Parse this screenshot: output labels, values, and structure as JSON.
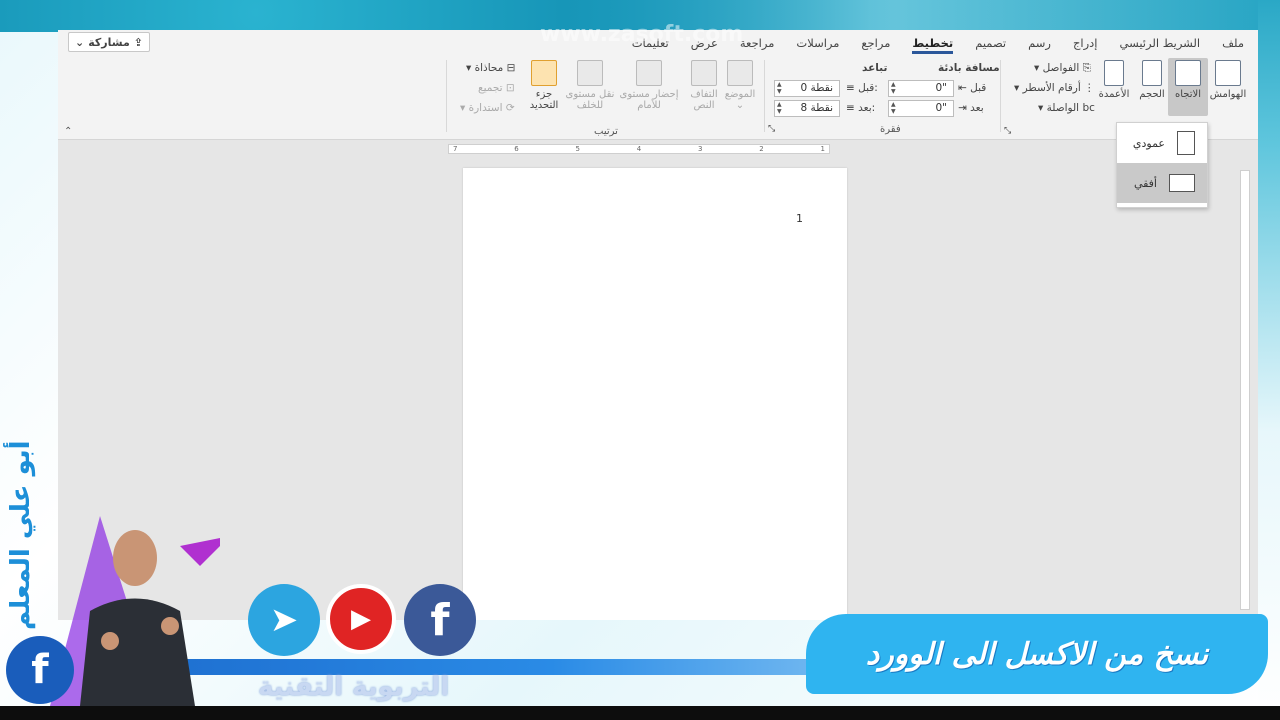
{
  "watermark": "www.zasoft.com",
  "tabs": [
    {
      "label": "ملف"
    },
    {
      "label": "الشريط الرئيسي"
    },
    {
      "label": "إدراج"
    },
    {
      "label": "رسم"
    },
    {
      "label": "تصميم"
    },
    {
      "label": "تخطيط",
      "active": true
    },
    {
      "label": "مراجع"
    },
    {
      "label": "مراسلات"
    },
    {
      "label": "مراجعة"
    },
    {
      "label": "عرض"
    },
    {
      "label": "تعليمات"
    }
  ],
  "share_label": "مشاركة",
  "ribbon": {
    "margins": "الهوامش",
    "orientation": "الاتجاه",
    "size": "الحجم",
    "columns": "الأعمدة",
    "breaks": "الفواصل",
    "line_numbers": "أرقام الأسطر",
    "hyphenation": "الواصلة",
    "indent_label": "مسافة بادئة",
    "spacing_label": "تباعد",
    "indent_before_label": "قبل",
    "indent_after_label": "بعد",
    "indent_before_value": "0\"",
    "indent_after_value": "0\"",
    "spacing_before_label": "قبل:",
    "spacing_after_label": "بعد:",
    "spacing_before_value": "0 نقطة",
    "spacing_after_value": "8 نقطة",
    "paragraph_group": "فقرة",
    "position": "الموضع",
    "wrap_text": "التفاف النص",
    "bring_forward": "إحضار مستوى للأمام",
    "send_backward": "نقل مستوى للخلف",
    "selection_pane": "جزء التحديد",
    "align": "محاذاة",
    "group": "تجميع",
    "rotate": "استدارة",
    "arrange_group": "ترتيب"
  },
  "orientation_menu": {
    "portrait": "عمودي",
    "landscape": "أفقي"
  },
  "document": {
    "page_number": "1"
  },
  "ruler_ticks": [
    "7",
    "6",
    "5",
    "4",
    "3",
    "2",
    "1"
  ],
  "overlay": {
    "vertical_name": "أبو علي المعلم",
    "brand": "التربوية التقنية",
    "title": "نسخ من الاكسل الى الوورد"
  },
  "colors": {
    "accent": "#2b579a",
    "banner": "#2fb4f0",
    "facebook": "#3b5998",
    "youtube": "#e02424",
    "telegram": "#2ca5e0"
  }
}
